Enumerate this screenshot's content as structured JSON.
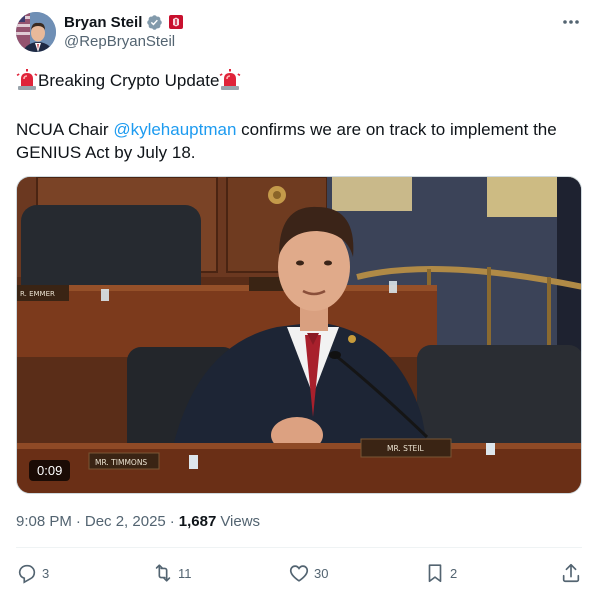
{
  "author": {
    "display_name": "Bryan Steil",
    "handle": "@RepBryanSteil"
  },
  "post": {
    "headline": "Breaking Crypto Update",
    "body_prefix": "NCUA Chair ",
    "mention": "@kylehauptman",
    "body_suffix": " confirms we are on track to implement the GENIUS Act by July 18."
  },
  "media": {
    "duration": "0:09",
    "nameplates": {
      "emmer": "R. EMMER",
      "timmons": "MR. TIMMONS",
      "steil": "MR. STEIL"
    }
  },
  "meta": {
    "time": "9:08 PM",
    "separator": "·",
    "date": "Dec 2, 2025",
    "views_count": "1,687",
    "views_label": "Views"
  },
  "actions": {
    "replies": "3",
    "reposts": "11",
    "likes": "30",
    "bookmarks": "2"
  },
  "colors": {
    "accent": "#1d9bf0",
    "secondary_text": "#536471"
  }
}
